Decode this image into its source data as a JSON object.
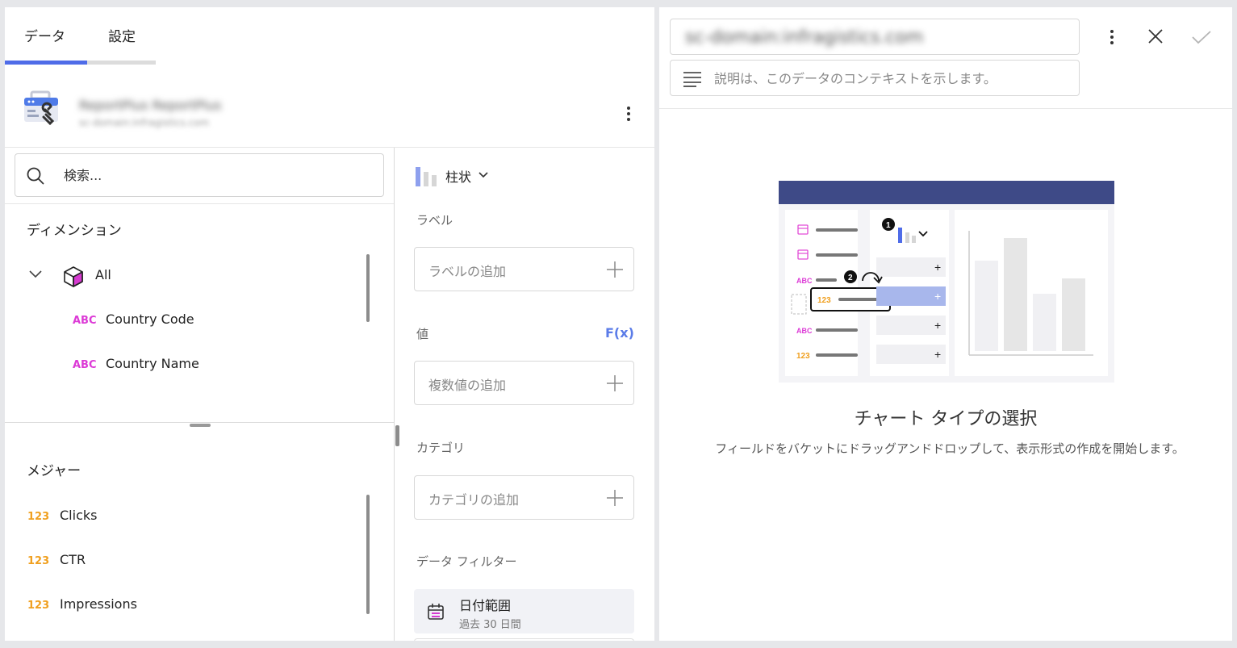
{
  "tabs": [
    {
      "label": "データ"
    },
    {
      "label": "設定"
    }
  ],
  "source": {
    "name": "ReportPlus ReportPlus",
    "subtitle": "sc-domain:infragistics.com"
  },
  "search": {
    "placeholder": "検索..."
  },
  "dimensions": {
    "title": "ディメンション",
    "group": "All",
    "fields": [
      {
        "type": "ABC",
        "name": "Country Code"
      },
      {
        "type": "ABC",
        "name": "Country Name"
      }
    ]
  },
  "measures": {
    "title": "メジャー",
    "fields": [
      {
        "type": "123",
        "name": "Clicks"
      },
      {
        "type": "123",
        "name": "CTR"
      },
      {
        "type": "123",
        "name": "Impressions"
      }
    ]
  },
  "chart_type": {
    "label": "柱状",
    "icon": "column-chart-icon"
  },
  "buckets": {
    "label": {
      "title": "ラベル",
      "placeholder": "ラベルの追加"
    },
    "values": {
      "title": "値",
      "fx": "F(x)",
      "placeholder": "複数値の追加"
    },
    "category": {
      "title": "カテゴリ",
      "placeholder": "カテゴリの追加"
    },
    "filters": {
      "title": "データ フィルター",
      "items": [
        {
          "title": "日付範囲",
          "subtitle": "過去 30 日間"
        }
      ]
    }
  },
  "editor": {
    "title_value": "sc-domain:infragistics.com",
    "description_placeholder": "説明は、このデータのコンテキストを示します。"
  },
  "empty_state": {
    "title": "チャート タイプの選択",
    "description": "フィールドをバケットにドラッグアンドドロップして、表示形式の作成を開始します。",
    "illustration": {
      "step1": "1",
      "step2": "2",
      "abc": "ABC",
      "num": "123",
      "plus": "+"
    }
  },
  "colors": {
    "accent": "#4f6ce8",
    "abc_type": "#dc3ad6",
    "num_type": "#f0a020",
    "illustration_header": "#3e4a87",
    "illustration_highlight": "#a8b7ec"
  }
}
